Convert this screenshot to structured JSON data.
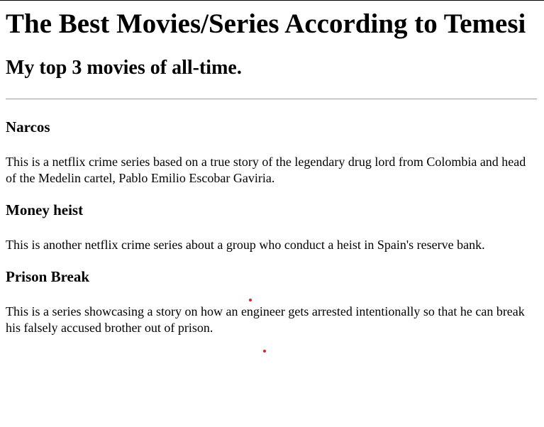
{
  "page": {
    "title": "The Best Movies/Series According to Temesi",
    "subtitle": "My top 3 movies of all-time."
  },
  "items": [
    {
      "title": "Narcos",
      "description": "This is a netflix crime series based on a true story of the legendary drug lord from Colombia and head of the Medelin cartel, Pablo Emilio Escobar Gaviria."
    },
    {
      "title": "Money heist",
      "description": "This is another netflix crime series about a group who conduct a heist in Spain's reserve bank."
    },
    {
      "title": "Prison Break",
      "description": "This is a series showcasing a story on how an engineer gets arrested intentionally so that he can break his falsely accused brother out of prison."
    }
  ],
  "colors": {
    "marker": "#e0202a",
    "divider": "#9a9a9a"
  }
}
